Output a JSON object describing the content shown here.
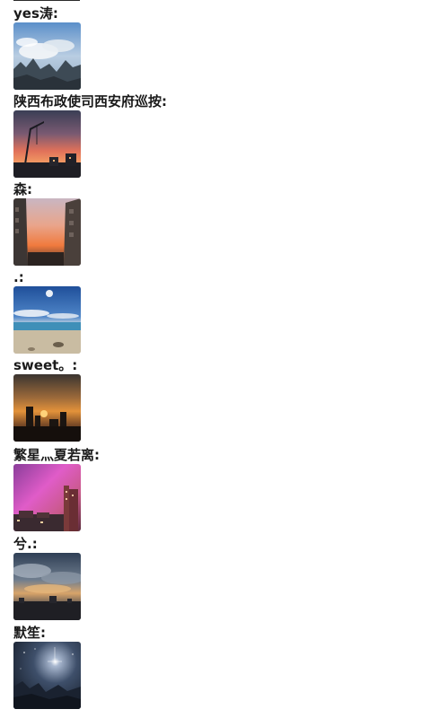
{
  "feed": {
    "posts": [
      {
        "username": "yes涛:",
        "photo": "mountain-sky-photo"
      },
      {
        "username": "陕西布政使司西安府巡按:",
        "photo": "crane-sunset-photo"
      },
      {
        "username": "森:",
        "photo": "street-sunset-photo"
      },
      {
        "username": ".:",
        "photo": "beach-blue-sky-photo"
      },
      {
        "username": "sweet。:",
        "photo": "city-sunset-silhouette-photo"
      },
      {
        "username": "繁星灬夏若离:",
        "photo": "pink-sky-buildings-photo"
      },
      {
        "username": "兮.:",
        "photo": "dramatic-clouds-photo"
      },
      {
        "username": "默笙:",
        "photo": "night-sky-sparkle-photo"
      }
    ]
  }
}
